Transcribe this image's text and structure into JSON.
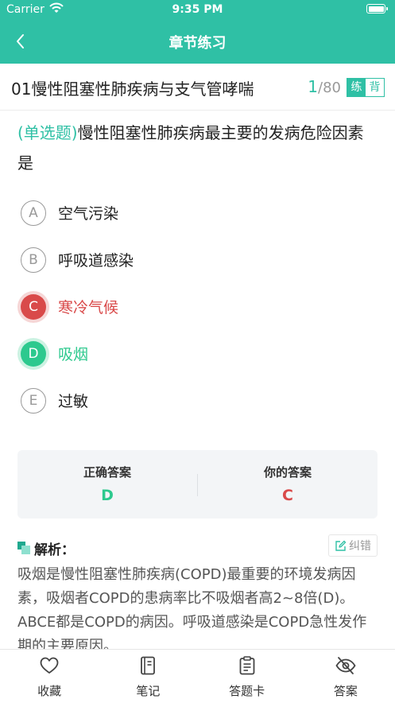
{
  "status_bar": {
    "carrier": "Carrier",
    "time": "9:35 PM"
  },
  "nav": {
    "title": "章节练习"
  },
  "chapter": {
    "name": "01慢性阻塞性肺疾病与支气管哮喘",
    "current": "1",
    "total": "/80",
    "mode_practice": "练",
    "mode_recite": "背"
  },
  "question": {
    "type": "(单选题)",
    "text": "慢性阻塞性肺疾病最主要的发病危险因素是"
  },
  "options": [
    {
      "letter": "A",
      "text": "空气污染",
      "state": "normal"
    },
    {
      "letter": "B",
      "text": "呼吸道感染",
      "state": "normal"
    },
    {
      "letter": "C",
      "text": "寒冷气候",
      "state": "wrong"
    },
    {
      "letter": "D",
      "text": "吸烟",
      "state": "correct"
    },
    {
      "letter": "E",
      "text": "过敏",
      "state": "normal"
    }
  ],
  "answers": {
    "correct_label": "正确答案",
    "correct_value": "D",
    "yours_label": "你的答案",
    "yours_value": "C"
  },
  "analysis": {
    "title": "解析：",
    "correction_label": "纠错",
    "text": "吸烟是慢性阻塞性肺疾病(COPD)最重要的环境发病因素，吸烟者COPD的患病率比不吸烟者高2~8倍(D)。ABCE都是COPD的病因。呼吸道感染是COPD急性发作期的主要原因。"
  },
  "tabbar": {
    "favorite": "收藏",
    "notes": "笔记",
    "answer_card": "答题卡",
    "answer": "答案"
  },
  "colors": {
    "brand": "#2fc0a5",
    "wrong": "#d94a4a",
    "correct": "#2dc98e"
  }
}
